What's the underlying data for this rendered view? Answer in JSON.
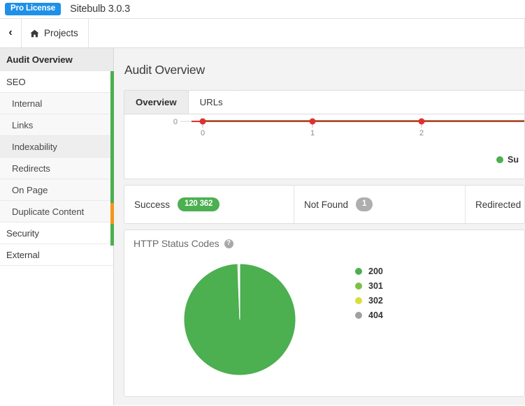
{
  "titlebar": {
    "license_badge": "Pro License",
    "app_title": "Sitebulb 3.0.3"
  },
  "toolbar": {
    "back_icon": "chevron-left-icon",
    "home_icon": "home-icon",
    "projects_label": "Projects"
  },
  "sidebar": {
    "items": [
      {
        "label": "Audit Overview",
        "level": "header",
        "state": "active"
      },
      {
        "label": "SEO",
        "level": "top",
        "state": "normal"
      },
      {
        "label": "Internal",
        "level": "sub",
        "state": "normal"
      },
      {
        "label": "Links",
        "level": "sub",
        "state": "normal"
      },
      {
        "label": "Indexability",
        "level": "sub",
        "state": "hover"
      },
      {
        "label": "Redirects",
        "level": "sub",
        "state": "normal"
      },
      {
        "label": "On Page",
        "level": "sub",
        "state": "normal"
      },
      {
        "label": "Duplicate Content",
        "level": "sub",
        "state": "normal"
      },
      {
        "label": "Security",
        "level": "top",
        "state": "normal"
      },
      {
        "label": "External",
        "level": "top",
        "state": "normal"
      }
    ],
    "rail": {
      "green": "#4caf50",
      "orange": "#f7941e"
    }
  },
  "main": {
    "page_title": "Audit Overview",
    "tabs": [
      {
        "label": "Overview",
        "active": true
      },
      {
        "label": "URLs",
        "active": false
      }
    ]
  },
  "trend_chart": {
    "legend_label": "Su",
    "legend_color": "#4caf50"
  },
  "stats": [
    {
      "label": "Success",
      "value": "120 362",
      "badge_color": "green"
    },
    {
      "label": "Not Found",
      "value": "1",
      "badge_color": "gray"
    },
    {
      "label": "Redirected",
      "value": "",
      "badge_color": "none"
    }
  ],
  "pie_panel": {
    "title": "HTTP Status Codes",
    "help_icon": "question-mark-icon",
    "help_glyph": "?"
  },
  "chart_data": [
    {
      "type": "line",
      "title": "",
      "xlabel": "",
      "ylabel": "",
      "x": [
        0,
        1,
        2
      ],
      "xticks": [
        "0",
        "1",
        "2"
      ],
      "yticks": [
        "0"
      ],
      "ylim": [
        0,
        1
      ],
      "grid": false,
      "legend_position": "bottom-right",
      "series": [
        {
          "name": "Su",
          "color": "#4caf50",
          "values": [
            0,
            0,
            0
          ]
        },
        {
          "name": "",
          "color": "#e03131",
          "values": [
            0,
            0,
            0
          ],
          "markers": true
        }
      ]
    },
    {
      "type": "pie",
      "title": "HTTP Status Codes",
      "legend_position": "right",
      "categories": [
        "200",
        "301",
        "302",
        "404"
      ],
      "values": [
        99.4,
        0.3,
        0.2,
        0.1
      ],
      "colors": [
        "#4caf50",
        "#7cc045",
        "#d7e03a",
        "#a0a0a0"
      ]
    }
  ]
}
